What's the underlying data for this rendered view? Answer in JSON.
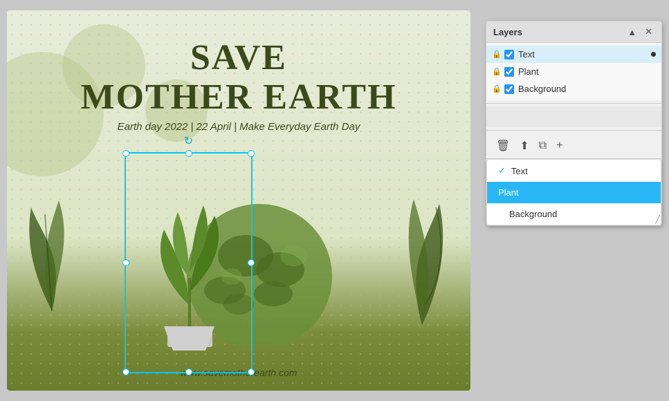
{
  "canvas": {
    "title_line1": "SAVE",
    "title_line2": "MOTHER EARTH",
    "subtitle": "Earth day 2022 | 22 April | Make Everyday Earth Day",
    "url": "www.savemotherearth.com"
  },
  "layers_panel": {
    "title": "Layers",
    "close_btn": "✕",
    "minimize_btn": "▲",
    "layers": [
      {
        "name": "Text",
        "visible": true,
        "locked": true,
        "active": true
      },
      {
        "name": "Plant",
        "visible": true,
        "locked": true,
        "active": false
      },
      {
        "name": "Background",
        "visible": true,
        "locked": true,
        "active": false
      }
    ],
    "toolbar": {
      "delete": "🗑",
      "export": "⬆",
      "duplicate": "⧉",
      "add": "+"
    },
    "dropdown": {
      "items": [
        {
          "label": "Text",
          "state": "checked"
        },
        {
          "label": "Plant",
          "state": "selected"
        },
        {
          "label": "Background",
          "state": "normal"
        }
      ]
    }
  }
}
